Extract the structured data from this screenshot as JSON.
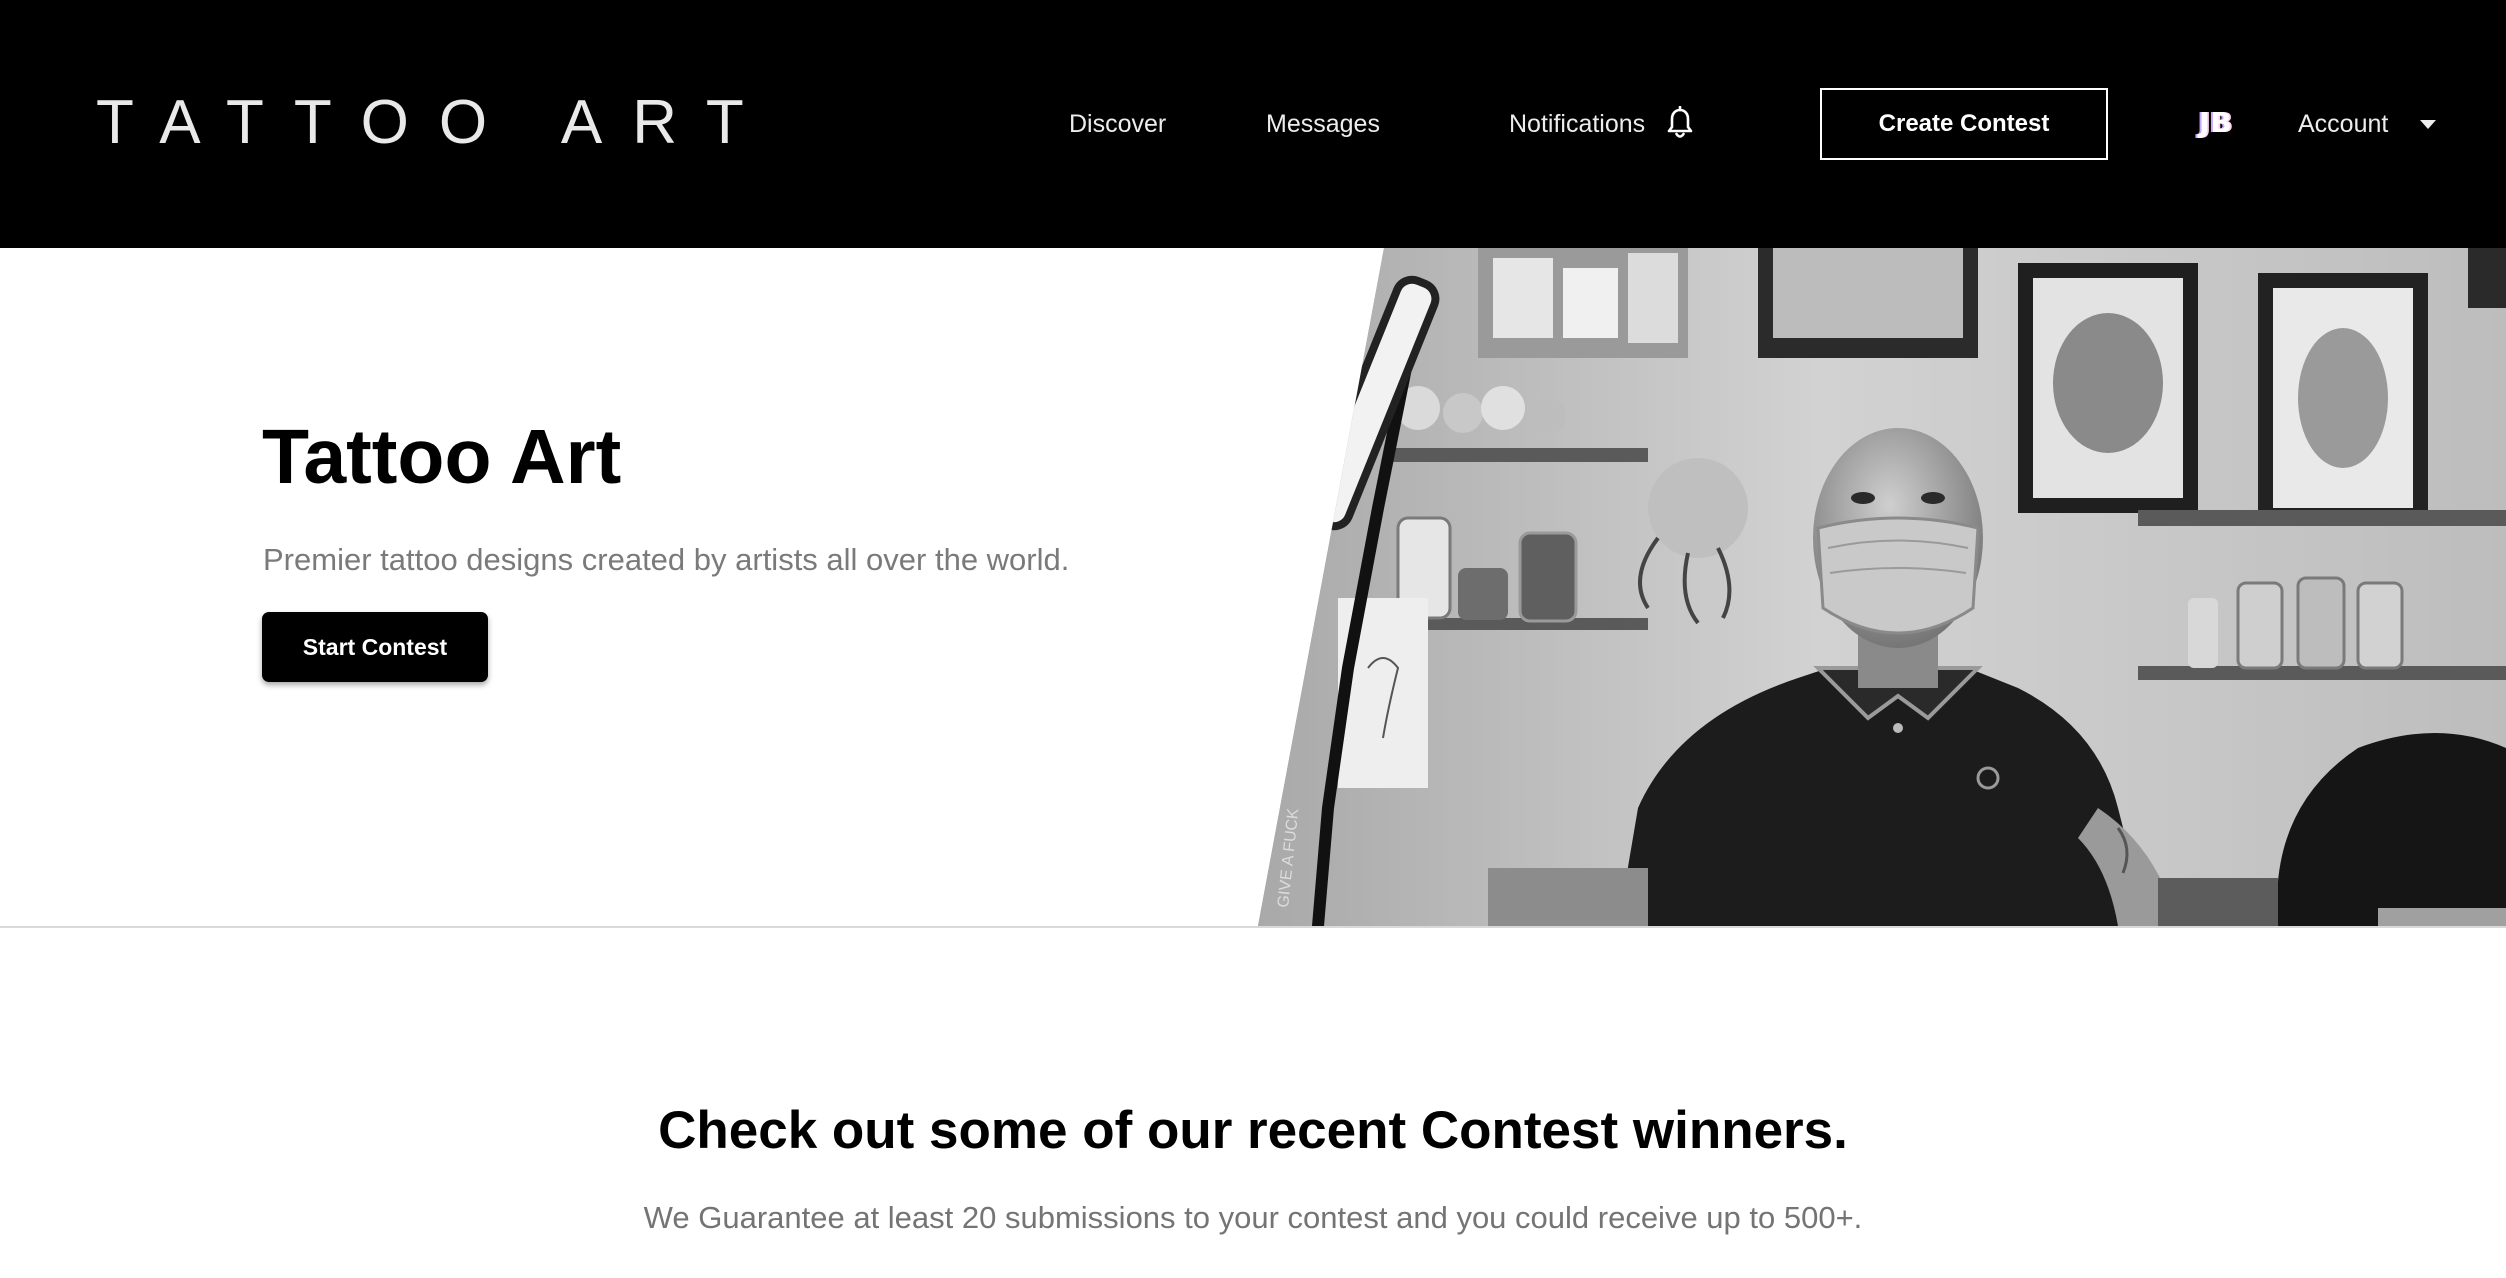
{
  "header": {
    "brand": "TATTOO ART",
    "nav": {
      "discover": "Discover",
      "messages": "Messages",
      "notifications": "Notifications"
    },
    "notifications_icon": "bell-icon",
    "create_contest_label": "Create Contest",
    "avatar_initials": "JB",
    "account_label": "Account",
    "account_icon": "chevron-down-icon"
  },
  "hero": {
    "title": "Tattoo Art",
    "subtitle": "Premier tattoo designs created by artists all over the world.",
    "cta_label": "Start Contest",
    "photo_sign_text": "GIVE A FUCK"
  },
  "winners": {
    "title": "Check out some of our recent Contest winners.",
    "subtitle": "We Guarantee at least 20 submissions to your contest and you could receive up to 500+."
  },
  "colors": {
    "header_bg": "#000000",
    "primary_button": "#000000",
    "muted_text": "#7a7a7a"
  }
}
